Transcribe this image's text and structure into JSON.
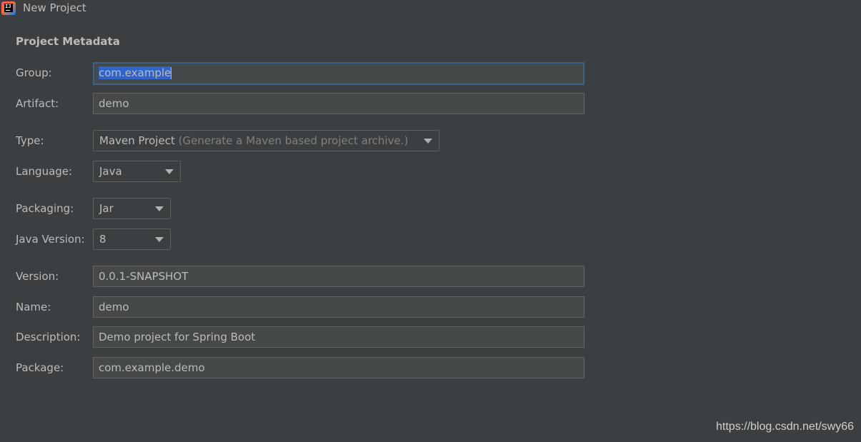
{
  "window": {
    "title": "New Project"
  },
  "section": {
    "title": "Project Metadata"
  },
  "form": {
    "group": {
      "label": "Group:",
      "value": "com.example"
    },
    "artifact": {
      "label": "Artifact:",
      "value": "demo"
    },
    "type": {
      "label": "Type:",
      "value": "Maven Project",
      "hint": "(Generate a Maven based project archive.)"
    },
    "language": {
      "label": "Language:",
      "value": "Java"
    },
    "packaging": {
      "label": "Packaging:",
      "value": "Jar"
    },
    "java_version": {
      "label": "Java Version:",
      "value": "8"
    },
    "version": {
      "label": "Version:",
      "value": "0.0.1-SNAPSHOT"
    },
    "name": {
      "label": "Name:",
      "value": "demo"
    },
    "description": {
      "label": "Description:",
      "value": "Demo project for Spring Boot"
    },
    "package": {
      "label": "Package:",
      "value": "com.example.demo"
    }
  },
  "watermark": {
    "text": "https://blog.csdn.net/swy66"
  },
  "icons": {
    "app": "intellij-idea-icon",
    "dropdown": "chevron-down-icon"
  },
  "colors": {
    "background": "#3c3f41",
    "field_background": "#45494a",
    "focus_border": "#3d6185",
    "selection": "#2f65ca",
    "text": "#bbbbbb",
    "hint_text": "#808080"
  }
}
